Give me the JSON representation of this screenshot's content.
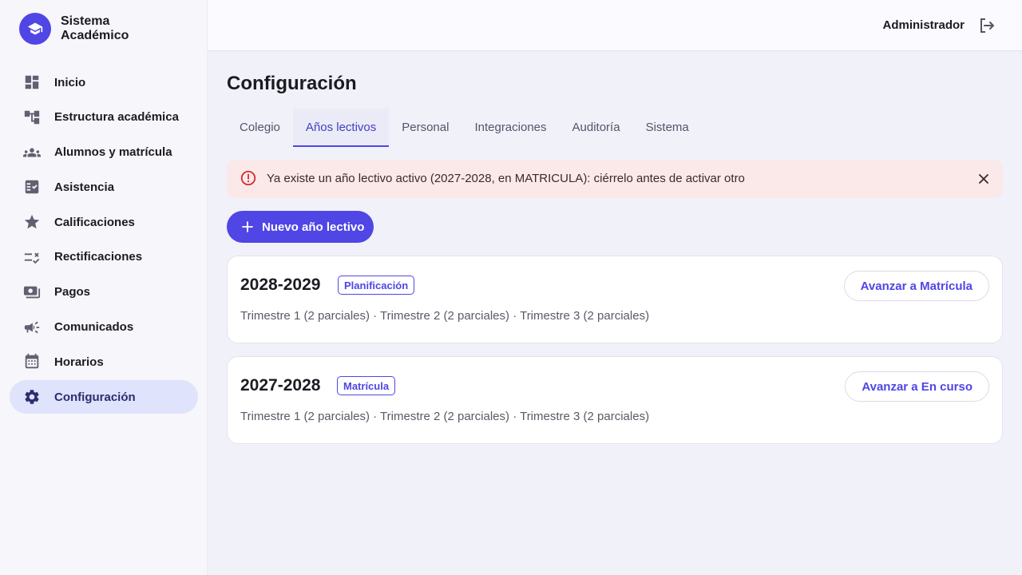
{
  "brand": {
    "name": "Sistema Académico",
    "icon": "graduation-cap-icon"
  },
  "sidebar": {
    "items": [
      {
        "label": "Inicio",
        "icon": "dashboard-icon",
        "active": false
      },
      {
        "label": "Estructura académica",
        "icon": "hierarchy-icon",
        "active": false
      },
      {
        "label": "Alumnos y matrícula",
        "icon": "group-icon",
        "active": false
      },
      {
        "label": "Asistencia",
        "icon": "checklist-icon",
        "active": false
      },
      {
        "label": "Calificaciones",
        "icon": "star-icon",
        "active": false
      },
      {
        "label": "Rectificaciones",
        "icon": "rule-edit-icon",
        "active": false
      },
      {
        "label": "Pagos",
        "icon": "payments-icon",
        "active": false
      },
      {
        "label": "Comunicados",
        "icon": "megaphone-icon",
        "active": false
      },
      {
        "label": "Horarios",
        "icon": "calendar-icon",
        "active": false
      },
      {
        "label": "Configuración",
        "icon": "gear-icon",
        "active": true
      }
    ]
  },
  "topbar": {
    "user": "Administrador",
    "logout_icon": "logout-icon"
  },
  "main": {
    "title": "Configuración",
    "tabs": [
      {
        "label": "Colegio",
        "active": false
      },
      {
        "label": "Años lectivos",
        "active": true
      },
      {
        "label": "Personal",
        "active": false
      },
      {
        "label": "Integraciones",
        "active": false
      },
      {
        "label": "Auditoría",
        "active": false
      },
      {
        "label": "Sistema",
        "active": false
      }
    ],
    "alert": {
      "text": "Ya existe un año lectivo activo (2027-2028, en MATRICULA): ciérrelo antes de activar otro"
    },
    "new_button": "Nuevo año lectivo",
    "years": [
      {
        "year": "2028-2029",
        "status": "Planificación",
        "desc": "Trimestre 1 (2 parciales) · Trimestre 2 (2 parciales) · Trimestre 3 (2 parciales)",
        "action": "Avanzar a Matrícula"
      },
      {
        "year": "2027-2028",
        "status": "Matrícula",
        "desc": "Trimestre 1 (2 parciales) · Trimestre 2 (2 parciales) · Trimestre 3 (2 parciales)",
        "action": "Avanzar a En curso"
      }
    ]
  },
  "colors": {
    "accent": "#4f46e5",
    "active_nav_bg": "#dfe3fb",
    "alert_bg": "#fbe9ea",
    "alert_icon": "#d32f2f"
  }
}
